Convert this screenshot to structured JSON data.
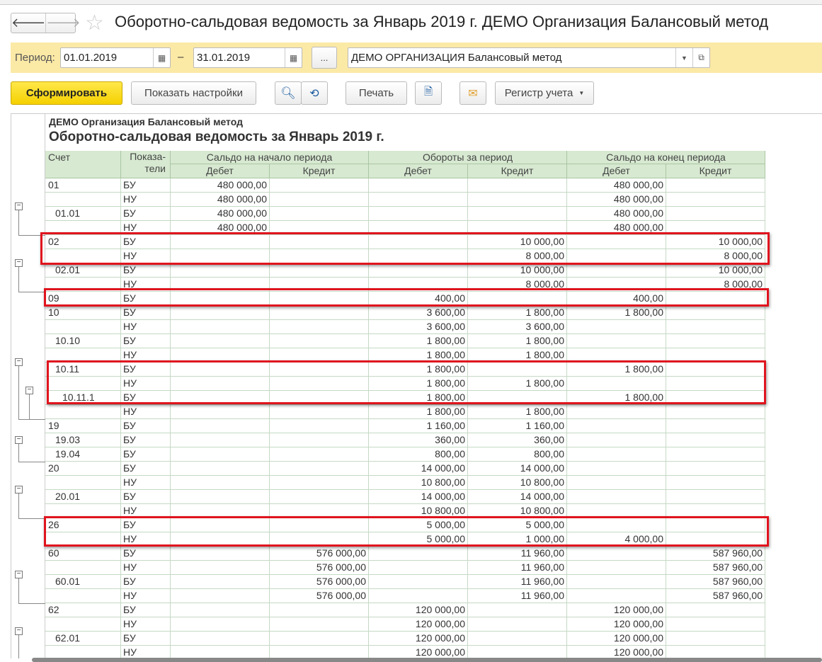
{
  "window": {
    "title": "Оборотно-сальдовая ведомость за Январь 2019 г. ДЕМО Организация Балансовый метод",
    "back": "🡐",
    "forward": "🡒",
    "star": "☆"
  },
  "period": {
    "label": "Период:",
    "from": "01.01.2019",
    "dash": "–",
    "to": "31.01.2019",
    "more": "...",
    "organization": "ДЕМО ОРГАНИЗАЦИЯ Балансовый метод"
  },
  "toolbar": {
    "generate": "Сформировать",
    "show_settings": "Показать настройки",
    "print": "Печать",
    "register": "Регистр учета"
  },
  "report": {
    "organization": "ДЕМО Организация Балансовый метод",
    "title": "Оборотно-сальдовая ведомость за Январь 2019 г.",
    "headers": {
      "account": "Счет",
      "indicators": "Показа-\nтели",
      "opening": "Сальдо на начало периода",
      "turnover": "Обороты за период",
      "closing": "Сальдо на конец периода",
      "debit": "Дебет",
      "credit": "Кредит"
    },
    "rows": [
      [
        "01",
        0,
        "БУ",
        "480 000,00",
        "",
        "",
        "",
        "480 000,00",
        ""
      ],
      [
        "",
        0,
        "НУ",
        "480 000,00",
        "",
        "",
        "",
        "480 000,00",
        ""
      ],
      [
        "01.01",
        1,
        "БУ",
        "480 000,00",
        "",
        "",
        "",
        "480 000,00",
        ""
      ],
      [
        "",
        0,
        "НУ",
        "480 000,00",
        "",
        "",
        "",
        "480 000,00",
        ""
      ],
      [
        "02",
        0,
        "БУ",
        "",
        "",
        "",
        "10 000,00",
        "",
        "10 000,00"
      ],
      [
        "",
        0,
        "НУ",
        "",
        "",
        "",
        "8 000,00",
        "",
        "8 000,00"
      ],
      [
        "02.01",
        1,
        "БУ",
        "",
        "",
        "",
        "10 000,00",
        "",
        "10 000,00"
      ],
      [
        "",
        0,
        "НУ",
        "",
        "",
        "",
        "8 000,00",
        "",
        "8 000,00"
      ],
      [
        "09",
        0,
        "БУ",
        "",
        "",
        "400,00",
        "",
        "400,00",
        ""
      ],
      [
        "10",
        0,
        "БУ",
        "",
        "",
        "3 600,00",
        "1 800,00",
        "1 800,00",
        ""
      ],
      [
        "",
        0,
        "НУ",
        "",
        "",
        "3 600,00",
        "3 600,00",
        "",
        ""
      ],
      [
        "10.10",
        1,
        "БУ",
        "",
        "",
        "1 800,00",
        "1 800,00",
        "",
        ""
      ],
      [
        "",
        0,
        "НУ",
        "",
        "",
        "1 800,00",
        "1 800,00",
        "",
        ""
      ],
      [
        "10.11",
        1,
        "БУ",
        "",
        "",
        "1 800,00",
        "",
        "1 800,00",
        ""
      ],
      [
        "",
        0,
        "НУ",
        "",
        "",
        "1 800,00",
        "1 800,00",
        "",
        ""
      ],
      [
        "10.11.1",
        2,
        "БУ",
        "",
        "",
        "1 800,00",
        "",
        "1 800,00",
        ""
      ],
      [
        "",
        0,
        "НУ",
        "",
        "",
        "1 800,00",
        "1 800,00",
        "",
        ""
      ],
      [
        "19",
        0,
        "БУ",
        "",
        "",
        "1 160,00",
        "1 160,00",
        "",
        ""
      ],
      [
        "19.03",
        1,
        "БУ",
        "",
        "",
        "360,00",
        "360,00",
        "",
        ""
      ],
      [
        "19.04",
        1,
        "БУ",
        "",
        "",
        "800,00",
        "800,00",
        "",
        ""
      ],
      [
        "20",
        0,
        "БУ",
        "",
        "",
        "14 000,00",
        "14 000,00",
        "",
        ""
      ],
      [
        "",
        0,
        "НУ",
        "",
        "",
        "10 800,00",
        "10 800,00",
        "",
        ""
      ],
      [
        "20.01",
        1,
        "БУ",
        "",
        "",
        "14 000,00",
        "14 000,00",
        "",
        ""
      ],
      [
        "",
        0,
        "НУ",
        "",
        "",
        "10 800,00",
        "10 800,00",
        "",
        ""
      ],
      [
        "26",
        0,
        "БУ",
        "",
        "",
        "5 000,00",
        "5 000,00",
        "",
        ""
      ],
      [
        "",
        0,
        "НУ",
        "",
        "",
        "5 000,00",
        "1 000,00",
        "4 000,00",
        ""
      ],
      [
        "60",
        0,
        "БУ",
        "",
        "576 000,00",
        "",
        "11 960,00",
        "",
        "587 960,00"
      ],
      [
        "",
        0,
        "НУ",
        "",
        "576 000,00",
        "",
        "11 960,00",
        "",
        "587 960,00"
      ],
      [
        "60.01",
        1,
        "БУ",
        "",
        "576 000,00",
        "",
        "11 960,00",
        "",
        "587 960,00"
      ],
      [
        "",
        0,
        "НУ",
        "",
        "576 000,00",
        "",
        "11 960,00",
        "",
        "587 960,00"
      ],
      [
        "62",
        0,
        "БУ",
        "",
        "",
        "120 000,00",
        "",
        "120 000,00",
        ""
      ],
      [
        "",
        0,
        "НУ",
        "",
        "",
        "120 000,00",
        "",
        "120 000,00",
        ""
      ],
      [
        "62.01",
        1,
        "БУ",
        "",
        "",
        "120 000,00",
        "",
        "120 000,00",
        ""
      ],
      [
        "",
        0,
        "НУ",
        "",
        "",
        "120 000,00",
        "",
        "120 000,00",
        ""
      ]
    ]
  }
}
